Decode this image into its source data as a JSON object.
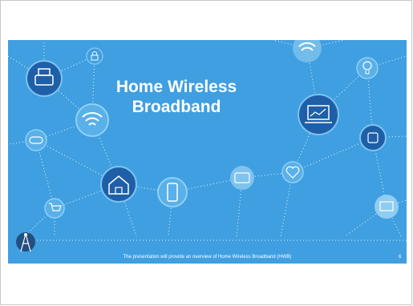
{
  "slide": {
    "title_line1": "Home Wireless",
    "title_line2": "Broadband",
    "footer_text": "The presentation will provide an overview of Home Wireless Broadband (HWB)",
    "page_number": "6"
  },
  "colors": {
    "background": "#3f9fe0",
    "icon_dark": "#1e5fa8",
    "icon_light": "#7fc3ee",
    "white": "#ffffff"
  },
  "icons": [
    "printer-icon",
    "lock-icon",
    "wifi-icon",
    "wifi-icon",
    "gamepad-icon",
    "house-icon",
    "phone-icon",
    "card-icon",
    "heart-icon",
    "laptop-chart-icon",
    "bulb-icon",
    "watch-icon",
    "cart-icon",
    "tv-icon",
    "radio-tower-icon"
  ]
}
